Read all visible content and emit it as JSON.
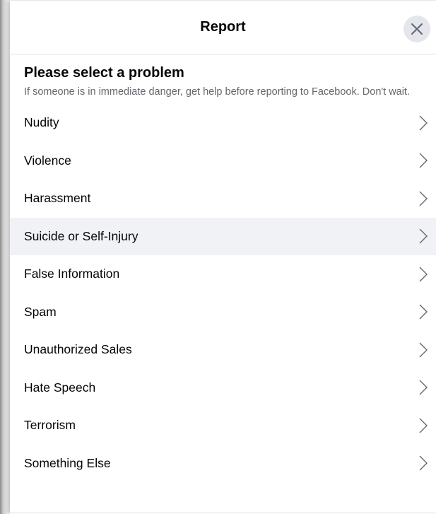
{
  "dialog": {
    "title": "Report",
    "close_icon": "close-x-icon"
  },
  "intro": {
    "heading": "Please select a problem",
    "subtext": "If someone is in immediate danger, get help before reporting to Facebook. Don't wait."
  },
  "options": [
    {
      "label": "Nudity",
      "icon": "chevron-right-icon"
    },
    {
      "label": "Violence",
      "icon": "chevron-right-icon"
    },
    {
      "label": "Harassment",
      "icon": "chevron-right-icon"
    },
    {
      "label": "Suicide or Self-Injury",
      "icon": "chevron-right-icon",
      "hovered": true
    },
    {
      "label": "False Information",
      "icon": "chevron-right-icon"
    },
    {
      "label": "Spam",
      "icon": "chevron-right-icon"
    },
    {
      "label": "Unauthorized Sales",
      "icon": "chevron-right-icon"
    },
    {
      "label": "Hate Speech",
      "icon": "chevron-right-icon"
    },
    {
      "label": "Terrorism",
      "icon": "chevron-right-icon"
    },
    {
      "label": "Something Else",
      "icon": "chevron-right-icon"
    }
  ],
  "colors": {
    "text_primary": "#050505",
    "text_secondary": "#65676b",
    "hover_background": "#f0f2f5",
    "close_button_background": "#e4e6eb",
    "divider": "#dddfe2"
  }
}
